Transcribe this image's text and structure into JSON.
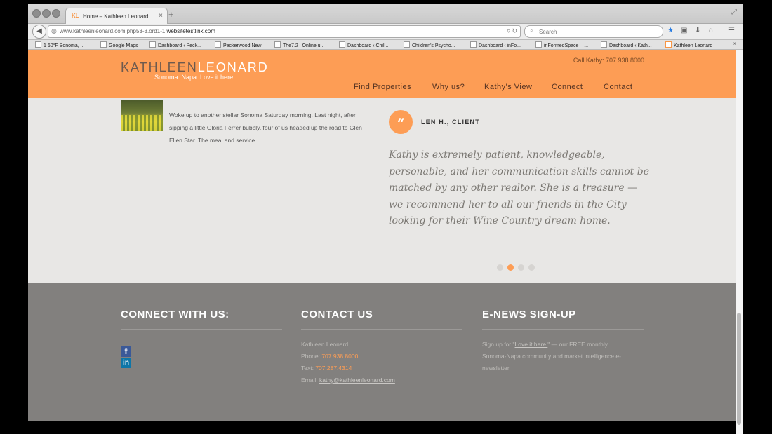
{
  "browser": {
    "tab_favicon": "KL",
    "tab_title": "Home – Kathleen Leonard...",
    "tab_close": "×",
    "new_tab": "+",
    "url_prefix": "www.kathleenleonard.com.php53-3.ord1-1.",
    "url_domain": "websitetestlink.com",
    "search_placeholder": "Search"
  },
  "bookmarks": [
    {
      "label": "1 60°F Sonoma, ..."
    },
    {
      "label": "Google Maps"
    },
    {
      "label": "Dashboard ‹ Peck..."
    },
    {
      "label": "Peckerwood New"
    },
    {
      "label": "The7.2 | Online u..."
    },
    {
      "label": "Dashboard ‹ Chil..."
    },
    {
      "label": "Children's Psycho..."
    },
    {
      "label": "Dashboard ‹ inFo..."
    },
    {
      "label": "inFormedSpace – ..."
    },
    {
      "label": "Dashboard ‹ Kath..."
    },
    {
      "label": "Kathleen Leonard"
    }
  ],
  "header": {
    "logo_first": "KATHLEEN",
    "logo_second": "LEONARD",
    "tagline": "Sonoma. Napa. Love it here.",
    "call": "Call Kathy: 707.938.8000",
    "nav": [
      "Find Properties",
      "Why us?",
      "Kathy's View",
      "Connect",
      "Contact"
    ]
  },
  "blog": {
    "snippet": "Woke up to another stellar Sonoma Saturday morning. Last night, after sipping a little Gloria Ferrer bubbly, four of us headed up the road to Glen Ellen Star. The meal and service..."
  },
  "testimonial": {
    "quote_mark": "“",
    "author": "LEN H., CLIENT",
    "text": "Kathy is extremely patient, knowledgeable, personable, and her communication skills cannot be matched by any other realtor. She is a treasure — we recommend her to all our friends in the City looking for their Wine Country dream home.",
    "active_slide": 2,
    "slide_count": 4
  },
  "footer": {
    "connect_title": "CONNECT WITH US:",
    "contact_title": "CONTACT US",
    "contact_name": "Kathleen Leonard",
    "phone_label": "Phone:",
    "phone": "707.938.8000",
    "text_label": "Text:",
    "text_phone": "707.287.4314",
    "email_label": "Email:",
    "email": "kathy@kathleenleonard.com",
    "enews_title": "E-NEWS SIGN-UP",
    "enews_pre": "Sign up for \"",
    "enews_link": "Love it here.",
    "enews_post": "\" — our FREE monthly Sonoma-Napa community and market intelligence e-newsletter.",
    "facebook": "f",
    "linkedin": "in"
  },
  "colors": {
    "accent_orange": "#fd9d55",
    "footer_gray": "#82807e"
  }
}
